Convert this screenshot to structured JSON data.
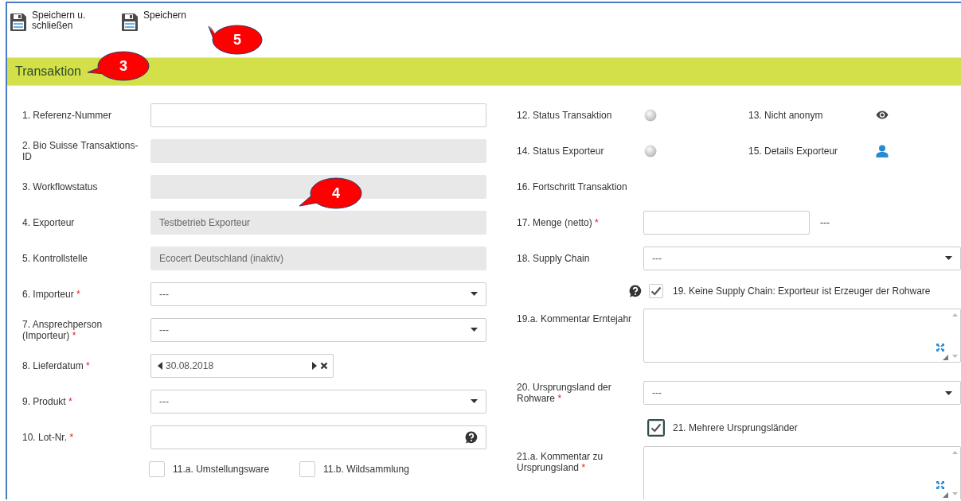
{
  "toolbar": [
    {
      "label": "Speichern u. schließen"
    },
    {
      "label": "Speichern"
    }
  ],
  "section": {
    "title": "Transaktion"
  },
  "left_fields": [
    {
      "kind": "text",
      "label": "1. Referenz-Nummer",
      "disabled": false
    },
    {
      "kind": "text",
      "label": "2. Bio Suisse Transaktions-ID",
      "disabled": true
    },
    {
      "kind": "text",
      "label": "3. Workflowstatus",
      "disabled": true
    },
    {
      "kind": "text",
      "label": "4. Exporteur",
      "value": "Testbetrieb Exporteur",
      "disabled": true
    },
    {
      "kind": "text",
      "label": "5. Kontrollstelle",
      "value": "Ecocert Deutschland (inaktiv)",
      "disabled": true
    },
    {
      "kind": "select",
      "label": "6. Importeur",
      "required": "*",
      "value": "---"
    },
    {
      "kind": "select",
      "label": "7. Ansprechperson (Importeur)",
      "required": "*",
      "value": "---"
    },
    {
      "kind": "date",
      "label": "8. Lieferdatum",
      "required": "*",
      "value": "30.08.2018"
    },
    {
      "kind": "select",
      "label": "9. Produkt",
      "required": "*",
      "value": "---"
    },
    {
      "kind": "help_text",
      "label": "10. Lot-Nr.",
      "required": "*",
      "disabled": false
    },
    {
      "kind": "checks",
      "items": [
        {
          "label": "11.a. Umstellungsware",
          "checked": false
        },
        {
          "label": "11.b. Wildsammlung",
          "checked": false
        }
      ]
    }
  ],
  "right_fields": [
    {
      "kind": "status_pair",
      "items": [
        {
          "label": "12. Status Transaktion",
          "kind": "dot"
        },
        {
          "label": "13. Nicht anonym",
          "kind": "eye"
        }
      ]
    },
    {
      "kind": "status_pair",
      "items": [
        {
          "label": "14. Status Exporteur",
          "kind": "dot"
        },
        {
          "label": "15. Details Exporteur",
          "kind": "person"
        }
      ]
    },
    {
      "kind": "info",
      "label": "16. Fortschritt Transaktion"
    },
    {
      "kind": "number",
      "label": "17. Menge (netto)",
      "required": "*",
      "unit": "---"
    },
    {
      "kind": "select",
      "label": "18. Supply Chain",
      "value": "---"
    },
    {
      "kind": "checkbox",
      "label": "19. Keine Supply Chain: Exporteur ist Erzeuger der Rohware",
      "checked": true,
      "help": true,
      "focused": false
    },
    {
      "kind": "textarea",
      "label": "19.a. Kommentar Erntejahr"
    },
    {
      "kind": "select",
      "label": "20. Ursprungsland der Rohware",
      "required": "*",
      "value": "---"
    },
    {
      "kind": "checkbox",
      "label": "21. Mehrere Ursprungsländer",
      "checked": true,
      "help": false,
      "focused": true
    },
    {
      "kind": "textarea",
      "label": "21.a. Kommentar zu Ursprungsland",
      "required": "*"
    }
  ],
  "callouts": [
    {
      "number": "5"
    },
    {
      "number": "3"
    },
    {
      "number": "4"
    }
  ]
}
